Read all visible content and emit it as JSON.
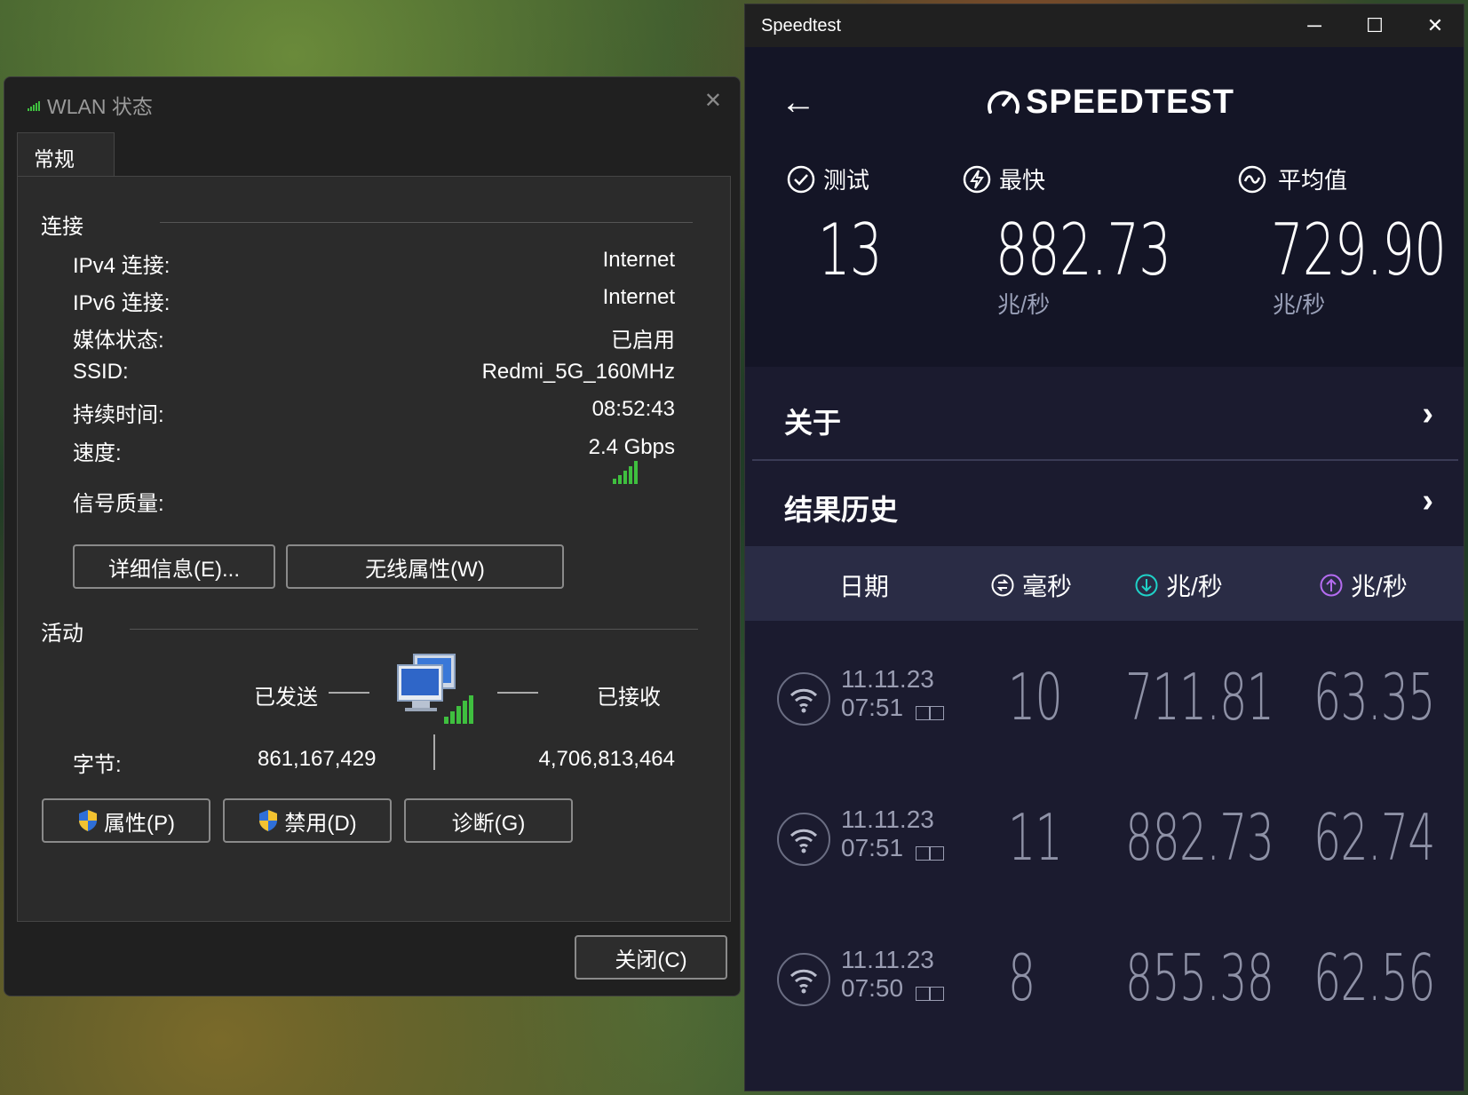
{
  "wlan": {
    "title": "WLAN 状态",
    "close_glyph": "✕",
    "tab": "常规",
    "connection_heading": "连接",
    "rows": [
      {
        "label": "IPv4 连接:",
        "value": "Internet"
      },
      {
        "label": "IPv6 连接:",
        "value": "Internet"
      },
      {
        "label": "媒体状态:",
        "value": "已启用"
      },
      {
        "label": "SSID:",
        "value": "Redmi_5G_160MHz"
      },
      {
        "label": "持续时间:",
        "value": "08:52:43"
      },
      {
        "label": "速度:",
        "value": "2.4 Gbps"
      }
    ],
    "signal_label": "信号质量:",
    "details_button": "详细信息(E)...",
    "wireless_button": "无线属性(W)",
    "activity_heading": "活动",
    "sent_label": "已发送",
    "received_label": "已接收",
    "bytes_label": "字节:",
    "bytes_sent": "861,167,429",
    "bytes_received": "4,706,813,464",
    "properties_button": "属性(P)",
    "disable_button": "禁用(D)",
    "diagnose_button": "诊断(G)",
    "close_button": "关闭(C)"
  },
  "speedtest": {
    "window_title": "Speedtest",
    "minimize_glyph": "─",
    "maximize_glyph": "☐",
    "close_glyph": "✕",
    "back_glyph": "←",
    "logo": "SPEEDTEST",
    "stats": {
      "tests_label": "测试",
      "tests_value": "13",
      "fastest_label": "最快",
      "fastest_value": "882.73",
      "fastest_unit": "兆/秒",
      "average_label": "平均值",
      "average_value": "729.90",
      "average_unit": "兆/秒"
    },
    "about_label": "关于",
    "history_label": "结果历史",
    "chevron_glyph": "›",
    "history_header": {
      "date": "日期",
      "ping": "毫秒",
      "download": "兆/秒",
      "upload": "兆/秒"
    },
    "history": [
      {
        "date": "11.11.23",
        "time": "07:51",
        "ping": "10",
        "download": "711.81",
        "upload": "63.35"
      },
      {
        "date": "11.11.23",
        "time": "07:51",
        "ping": "11",
        "download": "882.73",
        "upload": "62.74"
      },
      {
        "date": "11.11.23",
        "time": "07:50",
        "ping": "8",
        "download": "855.38",
        "upload": "62.56"
      }
    ],
    "colors": {
      "accent_download": "#1fd1c7",
      "accent_upload": "#b46cf0",
      "background": "#1b1b2f",
      "header_bg": "#141526"
    }
  }
}
